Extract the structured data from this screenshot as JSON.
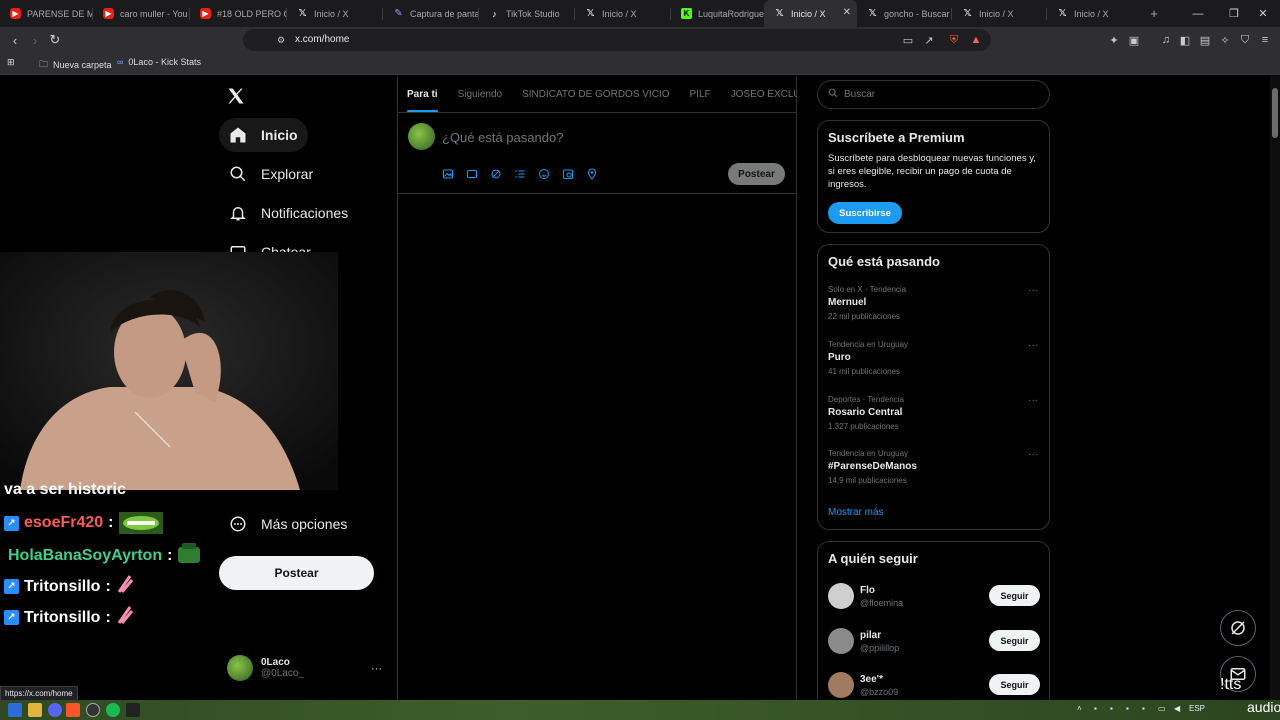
{
  "browser": {
    "tabs": [
      {
        "label": "PARENSE DE MA",
        "icon": "youtube-icon"
      },
      {
        "label": "caro muller - You",
        "icon": "youtube-icon"
      },
      {
        "label": "#18 OLD PERO G",
        "icon": "youtube-icon"
      },
      {
        "label": "Inicio / X",
        "icon": "x-icon"
      },
      {
        "label": "Captura de panta",
        "icon": "capture-icon"
      },
      {
        "label": "TikTok Studio",
        "icon": "tiktok-icon"
      },
      {
        "label": "Inicio / X",
        "icon": "x-icon"
      },
      {
        "label": "LuquitaRodrigue",
        "icon": "kick-icon"
      },
      {
        "label": "Inicio / X",
        "icon": "x-icon",
        "active": true
      },
      {
        "label": "goncho - Buscar",
        "icon": "x-icon"
      },
      {
        "label": "Inicio / X",
        "icon": "x-icon"
      },
      {
        "label": "Inicio / X",
        "icon": "x-icon"
      }
    ],
    "url": "x.com/home",
    "bookmarks": [
      "Nueva carpeta",
      "0Laco - Kick Stats"
    ],
    "status_url": "https://x.com/home"
  },
  "sidebar": {
    "items": [
      {
        "label": "Inicio",
        "icon": "home-icon",
        "active": true
      },
      {
        "label": "Explorar",
        "icon": "search-icon"
      },
      {
        "label": "Notificaciones",
        "icon": "bell-icon"
      },
      {
        "label": "Chatear",
        "icon": "mail-icon"
      },
      {
        "label": "Más opciones",
        "icon": "more-options-icon"
      }
    ],
    "post_button": "Postear",
    "account": {
      "name": "0Laco",
      "handle": "@0Laco_"
    }
  },
  "feed": {
    "tabs": [
      "Para ti",
      "Siguiendo",
      "SINDICATO DE GORDOS VICIO",
      "PILF",
      "JOSEO EXCLUSI"
    ],
    "active_tab": "Para ti",
    "composer_placeholder": "¿Qué está pasando?",
    "composer_post": "Postear"
  },
  "right": {
    "search_placeholder": "Buscar",
    "premium": {
      "title": "Suscríbete a Premium",
      "body": "Suscríbete para desbloquear nuevas funciones y, si eres elegible, recibir un pago de cuota de ingresos.",
      "button": "Suscribirse"
    },
    "trends": {
      "title": "Qué está pasando",
      "items": [
        {
          "meta": "Solo en X · Tendencia",
          "name": "Mernuel",
          "count": "22 mil publicaciones"
        },
        {
          "meta": "Tendencia en Uruguay",
          "name": "Puro",
          "count": "41 mil publicaciones"
        },
        {
          "meta": "Deportes · Tendencia",
          "name": "Rosario Central",
          "count": "1.327 publicaciones"
        },
        {
          "meta": "Tendencia en Uruguay",
          "name": "#ParenseDeManos",
          "count": "14,9 mil publicaciones"
        }
      ],
      "show_more": "Mostrar más"
    },
    "who_to_follow": {
      "title": "A quién seguir",
      "users": [
        {
          "name": "Flo",
          "handle": "@floemina",
          "button": "Seguir"
        },
        {
          "name": "pilar",
          "handle": "@ppilillop",
          "button": "Seguir"
        },
        {
          "name": "3ee'*",
          "handle": "@bzzo09",
          "button": "Seguir"
        }
      ]
    }
  },
  "overlay": {
    "chat": [
      {
        "user": "va a ser historic",
        "color": "#ffffff",
        "badge": false
      },
      {
        "user": "esoeFr420",
        "color": "#ff5a5a",
        "badge": true
      },
      {
        "user": "HolaBanaSoyAyrton",
        "color": "#3fd08a",
        "badge": false
      },
      {
        "user": "Tritonsillo",
        "color": "#ffffff",
        "badge": true
      },
      {
        "user": "Tritonsillo",
        "color": "#ffffff",
        "badge": true
      }
    ],
    "colon": ":",
    "tts_label": "!tts",
    "audios_label": "audios"
  },
  "taskbar": {
    "lang": "ESP"
  },
  "colors": {
    "accent": "#1d9bf0",
    "background": "#000000",
    "border": "#2f3336"
  }
}
